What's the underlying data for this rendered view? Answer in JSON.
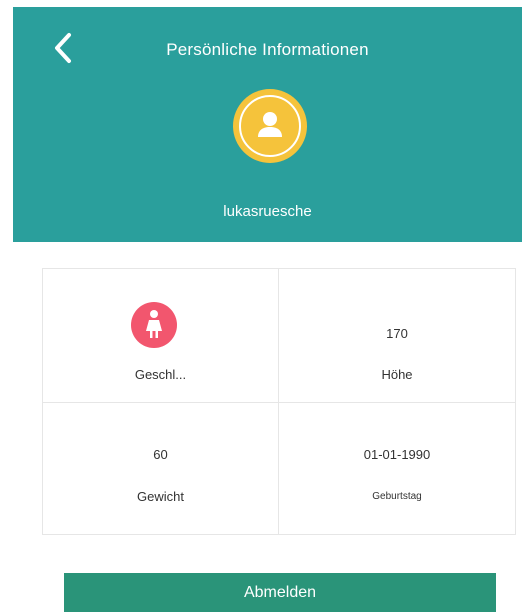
{
  "header": {
    "title": "Persönliche Informationen",
    "back_icon": "chevron-left-icon",
    "background_color": "#2a9f9c"
  },
  "profile": {
    "avatar_icon": "user-avatar-icon",
    "avatar_color": "#f5c33b",
    "username": "lukasruesche"
  },
  "info_grid": {
    "gender": {
      "icon": "female-icon",
      "icon_color": "#f2566e",
      "label": "Geschl..."
    },
    "height": {
      "value": "170",
      "label": "Höhe"
    },
    "weight": {
      "value": "60",
      "label": "Gewicht"
    },
    "birthday": {
      "value": "01-01-1990",
      "label": "Geburtstag"
    }
  },
  "actions": {
    "logout_label": "Abmelden",
    "logout_color": "#2a9479"
  }
}
